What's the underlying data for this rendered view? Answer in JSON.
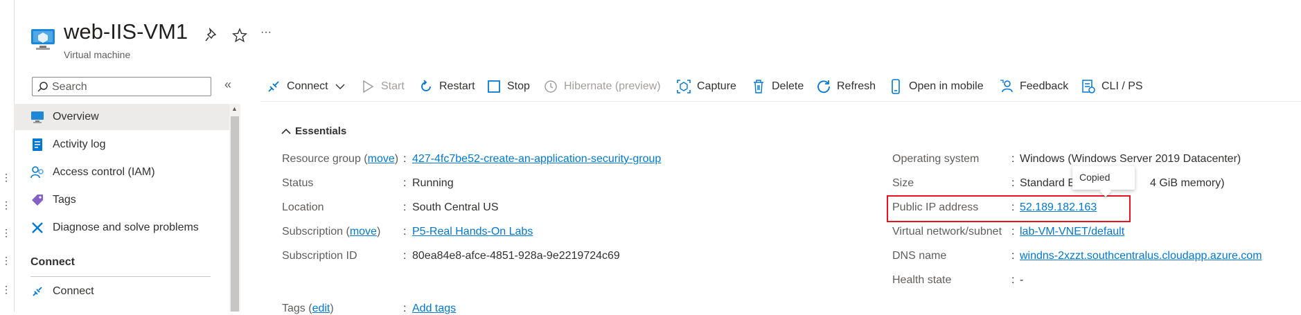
{
  "header": {
    "title": "web-IIS-VM1",
    "subtitle": "Virtual machine",
    "icons": [
      "vm-icon",
      "pin-icon",
      "star-icon",
      "more-icon"
    ],
    "more": "···"
  },
  "search": {
    "placeholder": "Search",
    "collapse": "«"
  },
  "sidebar": {
    "items": [
      {
        "label": "Overview",
        "icon": "overview-icon",
        "active": true
      },
      {
        "label": "Activity log",
        "icon": "activity-log-icon"
      },
      {
        "label": "Access control (IAM)",
        "icon": "iam-icon"
      },
      {
        "label": "Tags",
        "icon": "tag-icon"
      },
      {
        "label": "Diagnose and solve problems",
        "icon": "wrench-icon"
      }
    ],
    "section": "Connect",
    "section_items": [
      {
        "label": "Connect",
        "icon": "connect-icon"
      }
    ]
  },
  "toolbar": {
    "connect": "Connect",
    "start": "Start",
    "restart": "Restart",
    "stop": "Stop",
    "hibernate": "Hibernate (preview)",
    "capture": "Capture",
    "delete": "Delete",
    "refresh": "Refresh",
    "open_mobile": "Open in mobile",
    "feedback": "Feedback",
    "cli": "CLI / PS"
  },
  "essentials": {
    "toggle": "Essentials",
    "left": {
      "resource_group": {
        "label": "Resource group",
        "move": "move",
        "value": "427-4fc7be52-create-an-application-security-group"
      },
      "status": {
        "label": "Status",
        "value": "Running"
      },
      "location": {
        "label": "Location",
        "value": "South Central US"
      },
      "subscription": {
        "label": "Subscription",
        "move": "move",
        "value": "P5-Real Hands-On Labs"
      },
      "subscription_id": {
        "label": "Subscription ID",
        "value": "80ea84e8-afce-4851-928a-9e2219724c69"
      },
      "tags": {
        "label": "Tags",
        "edit": "edit",
        "value": "Add tags"
      }
    },
    "right": {
      "os": {
        "label": "Operating system",
        "value": "Windows (Windows Server 2019 Datacenter)"
      },
      "size": {
        "label": "Size",
        "value": "Standard B",
        "value_tail": "4 GiB memory)"
      },
      "public_ip": {
        "label": "Public IP address",
        "value": "52.189.182.163"
      },
      "vnet": {
        "label": "Virtual network/subnet",
        "value": "lab-VM-VNET/default"
      },
      "dns": {
        "label": "DNS name",
        "value": "windns-2xzzt.southcentralus.cloudapp.azure.com"
      },
      "health": {
        "label": "Health state",
        "value": "-"
      }
    }
  },
  "tooltip": {
    "text": "Copied"
  },
  "colors": {
    "accent": "#0078d4",
    "highlight": "#e81123",
    "active_bg": "#edebe9"
  }
}
